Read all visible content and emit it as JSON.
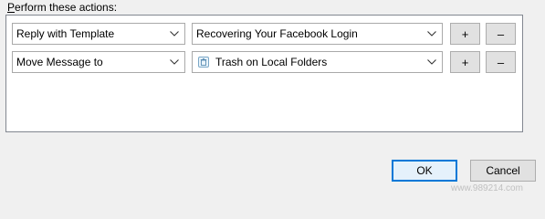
{
  "section": {
    "label_mnemonic": "P",
    "label_rest": "erform these actions:"
  },
  "actions": [
    {
      "type_value": "Reply with Template",
      "target_value": "Recovering Your Facebook Login",
      "add_label": "+",
      "remove_label": "–"
    },
    {
      "type_value": "Move Message to",
      "target_value": "Trash on Local Folders",
      "target_icon": "trash-folder-icon",
      "add_label": "+",
      "remove_label": "–"
    }
  ],
  "footer": {
    "ok_label": "OK",
    "cancel_label": "Cancel"
  },
  "watermark": "www.989214.com",
  "colors": {
    "panel_border": "#828790",
    "focus_accent": "#0078d7",
    "button_face": "#e1e1e1"
  }
}
